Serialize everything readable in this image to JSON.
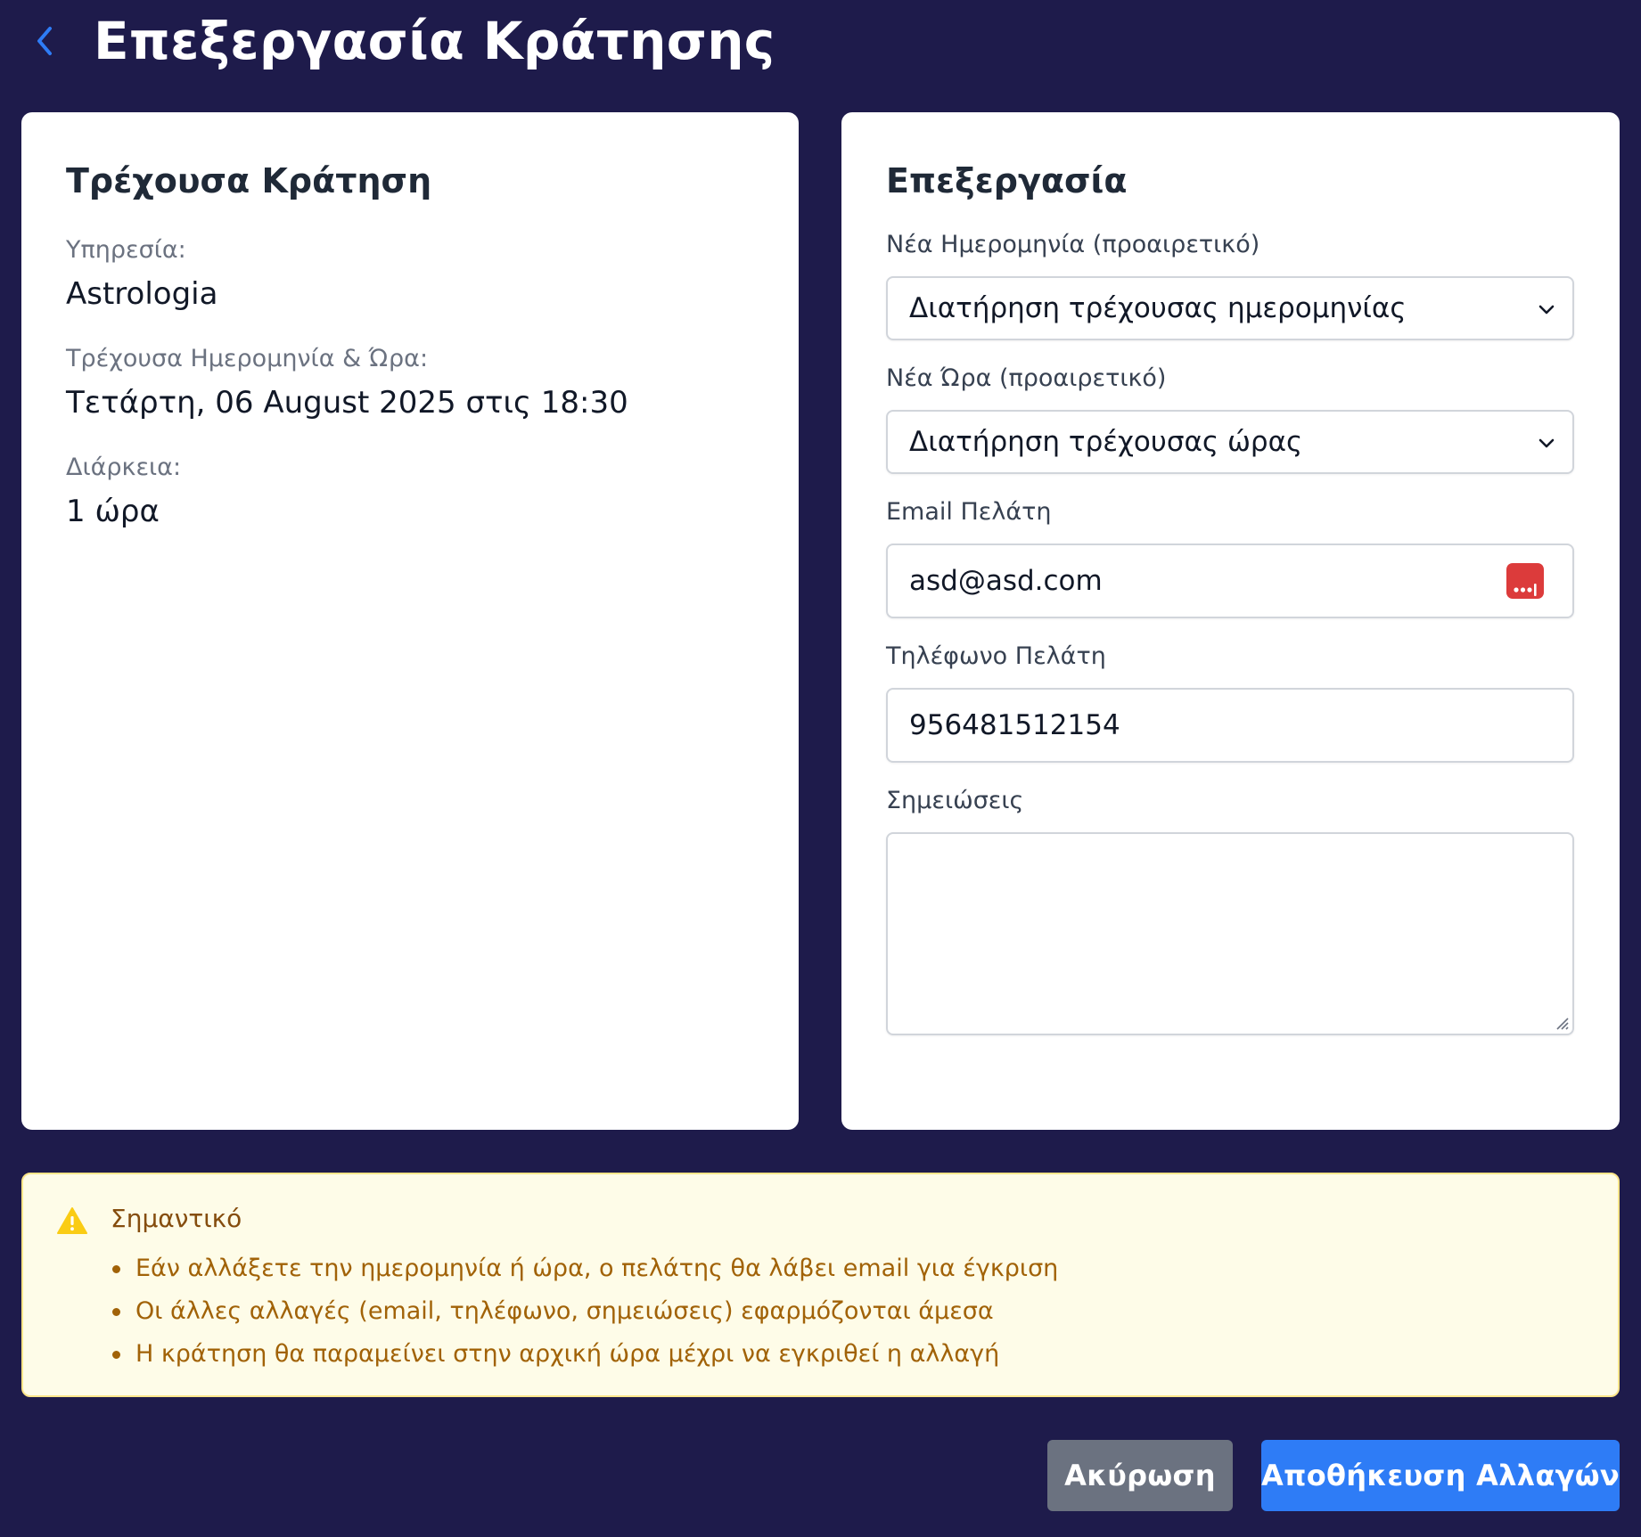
{
  "header": {
    "title": "Επεξεργασία Κράτησης",
    "back_icon": "chevron-left-icon",
    "back_color": "#2e7cf6"
  },
  "current_booking": {
    "title": "Τρέχουσα Κράτηση",
    "service_label": "Υπηρεσία:",
    "service_value": "Astrologia",
    "datetime_label": "Τρέχουσα Ημερομηνία & Ώρα:",
    "datetime_value": "Τετάρτη, 06 August 2025 στις 18:30",
    "duration_label": "Διάρκεια:",
    "duration_value": "1 ώρα"
  },
  "edit": {
    "title": "Επεξεργασία",
    "date_label": "Νέα Ημερομηνία (προαιρετικό)",
    "date_selected": "Διατήρηση τρέχουσας ημερομηνίας",
    "time_label": "Νέα Ώρα (προαιρετικό)",
    "time_selected": "Διατήρηση τρέχουσας ώρας",
    "email_label": "Email Πελάτη",
    "email_value": "asd@asd.com",
    "phone_label": "Τηλέφωνο Πελάτη",
    "phone_value": "956481512154",
    "notes_label": "Σημειώσεις",
    "notes_value": ""
  },
  "notice": {
    "icon": "warning-icon",
    "title": "Σημαντικό",
    "items": [
      "Εάν αλλάξετε την ημερομηνία ή ώρα, ο πελάτης θα λάβει email για έγκριση",
      "Οι άλλες αλλαγές (email, τηλέφωνο, σημειώσεις) εφαρμόζονται άμεσα",
      "Η κράτηση θα παραμείνει στην αρχική ώρα μέχρι να εγκριθεί η αλλαγή"
    ]
  },
  "actions": {
    "cancel_label": "Ακύρωση",
    "save_label": "Αποθήκευση Αλλαγών"
  },
  "colors": {
    "background": "#1e1b4b",
    "primary": "#2e7cf6",
    "secondary": "#6b7280",
    "warning_bg": "#fefce8",
    "warning_text": "#a16207",
    "password_manager": "#dc3b3b"
  }
}
